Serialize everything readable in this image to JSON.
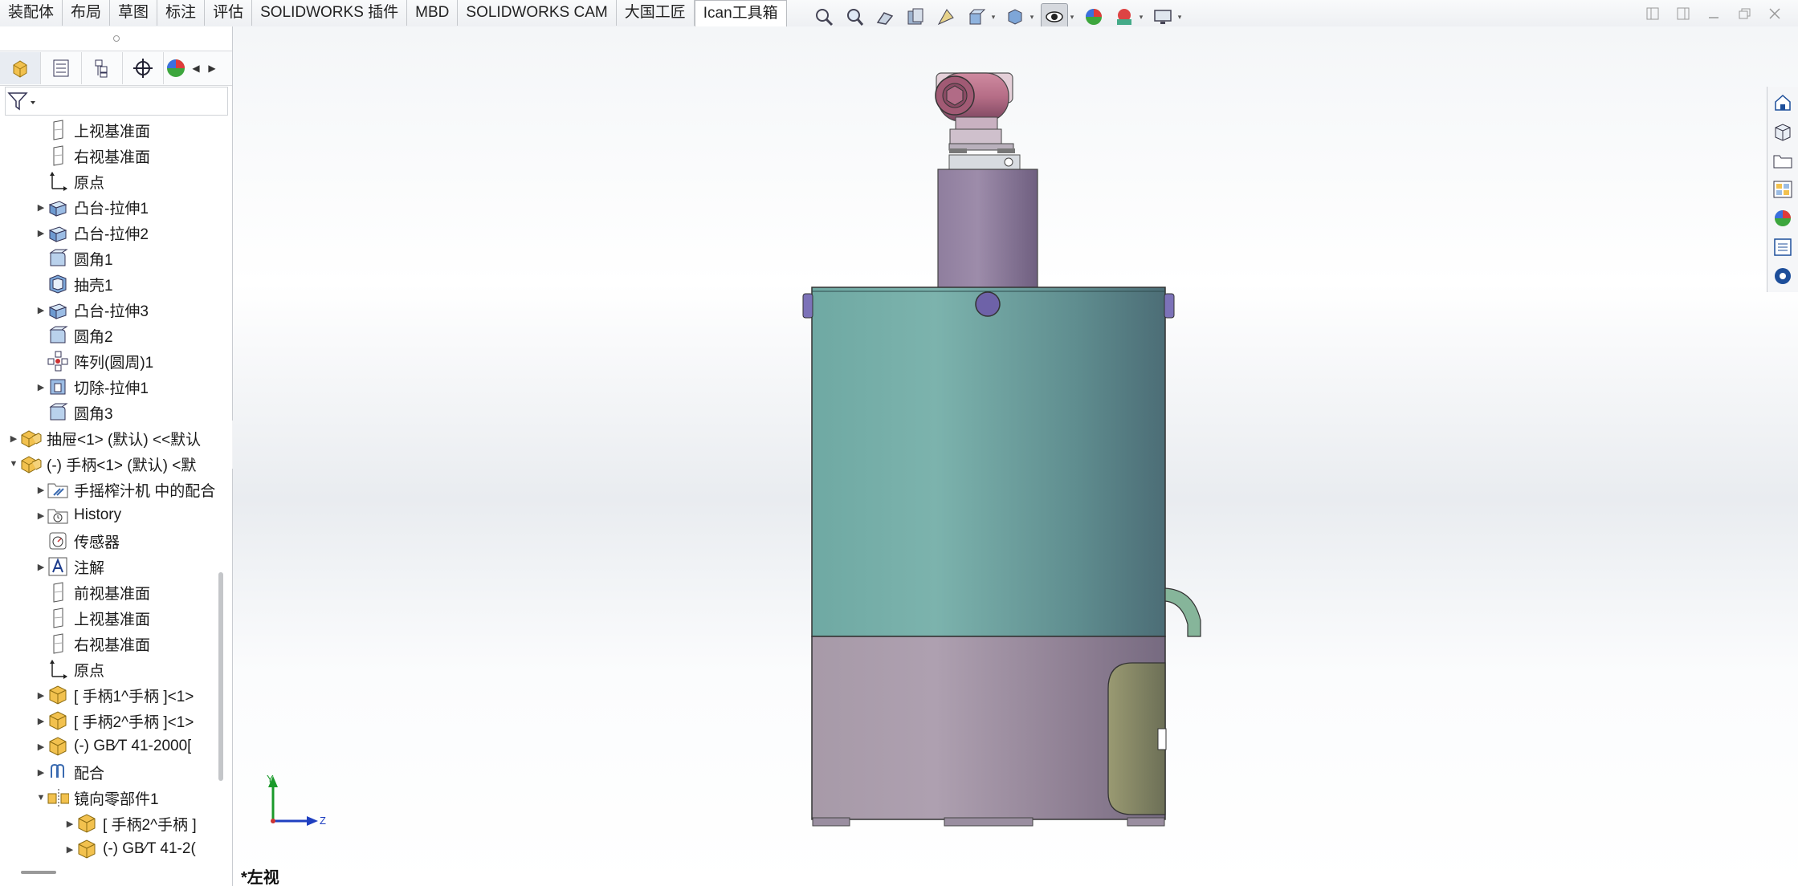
{
  "tabs": [
    "装配体",
    "布局",
    "草图",
    "标注",
    "评估",
    "SOLIDWORKS 插件",
    "MBD",
    "SOLIDWORKS CAM",
    "大国工匠",
    "Ican工具箱"
  ],
  "active_tab": "Ican工具箱",
  "tree": {
    "items": [
      {
        "label": "上视基准面",
        "icon": "plane-icon",
        "expand": "",
        "indent": 1
      },
      {
        "label": "右视基准面",
        "icon": "plane-icon",
        "expand": "",
        "indent": 1
      },
      {
        "label": "原点",
        "icon": "origin-icon",
        "expand": "",
        "indent": 1
      },
      {
        "label": "凸台-拉伸1",
        "icon": "boss-extrude-icon",
        "expand": "▶",
        "indent": 1
      },
      {
        "label": "凸台-拉伸2",
        "icon": "boss-extrude-icon",
        "expand": "▶",
        "indent": 1
      },
      {
        "label": "圆角1",
        "icon": "fillet-icon",
        "expand": "",
        "indent": 1
      },
      {
        "label": "抽壳1",
        "icon": "shell-icon",
        "expand": "",
        "indent": 1
      },
      {
        "label": "凸台-拉伸3",
        "icon": "boss-extrude-icon",
        "expand": "▶",
        "indent": 1
      },
      {
        "label": "圆角2",
        "icon": "fillet-icon",
        "expand": "",
        "indent": 1
      },
      {
        "label": "阵列(圆周)1",
        "icon": "circular-pattern-icon",
        "expand": "",
        "indent": 1
      },
      {
        "label": "切除-拉伸1",
        "icon": "cut-extrude-icon",
        "expand": "▶",
        "indent": 1
      },
      {
        "label": "圆角3",
        "icon": "fillet-icon",
        "expand": "",
        "indent": 1
      },
      {
        "label": "抽屉<1> (默认) <<默认",
        "icon": "assembly-icon",
        "expand": "▶",
        "indent": 0
      },
      {
        "label": "(-) 手柄<1> (默认) <默",
        "icon": "assembly-icon",
        "expand": "▼",
        "indent": 0
      },
      {
        "label": "手摇榨汁机 中的配合",
        "icon": "mates-folder-icon",
        "expand": "▶",
        "indent": 1
      },
      {
        "label": "History",
        "icon": "history-icon",
        "expand": "▶",
        "indent": 1
      },
      {
        "label": "传感器",
        "icon": "sensor-icon",
        "expand": "",
        "indent": 1
      },
      {
        "label": "注解",
        "icon": "annotation-icon",
        "expand": "▶",
        "indent": 1
      },
      {
        "label": "前视基准面",
        "icon": "plane-icon",
        "expand": "",
        "indent": 1
      },
      {
        "label": "上视基准面",
        "icon": "plane-icon",
        "expand": "",
        "indent": 1
      },
      {
        "label": "右视基准面",
        "icon": "plane-icon",
        "expand": "",
        "indent": 1
      },
      {
        "label": "原点",
        "icon": "origin-icon",
        "expand": "",
        "indent": 1
      },
      {
        "label": "[ 手柄1^手柄 ]<1>",
        "icon": "part-icon",
        "expand": "▶",
        "indent": 1
      },
      {
        "label": "[ 手柄2^手柄 ]<1>",
        "icon": "part-icon",
        "expand": "▶",
        "indent": 1
      },
      {
        "label": "(-) GB∕T 41-2000[",
        "icon": "part-icon",
        "expand": "▶",
        "indent": 1
      },
      {
        "label": "配合",
        "icon": "mate-icon",
        "expand": "▶",
        "indent": 1
      },
      {
        "label": "镜向零部件1",
        "icon": "mirror-component-icon",
        "expand": "▼",
        "indent": 1
      },
      {
        "label": "[ 手柄2^手柄 ]",
        "icon": "part-icon",
        "expand": "▶",
        "indent": 2
      },
      {
        "label": "(-) GB∕T 41-2(",
        "icon": "part-icon",
        "expand": "▶",
        "indent": 2
      }
    ]
  },
  "viewport": {
    "view_name": "*左视",
    "triad": {
      "y_label": "Y",
      "z_label": "Z"
    }
  },
  "hud_icons": [
    "zoom-to-fit-icon",
    "zoom-to-area-icon",
    "previous-view-icon",
    "section-view-icon",
    "dynamic-annotation-icon",
    "view-orientation-icon",
    "display-style-icon",
    "hide-show-items-icon",
    "edit-appearance-icon",
    "apply-scene-icon",
    "view-settings-icon"
  ],
  "taskpane_icons": [
    "solidworks-resources-icon",
    "design-library-icon",
    "file-explorer-icon",
    "view-palette-icon",
    "appearances-icon",
    "custom-properties-icon",
    "solidworks-forum-icon"
  ],
  "colors": {
    "housing_teal": "#6fa9a3",
    "base_mauve": "#a79aa8",
    "column_purple": "#8f7e9e",
    "motor_pink": "#b56d86"
  }
}
